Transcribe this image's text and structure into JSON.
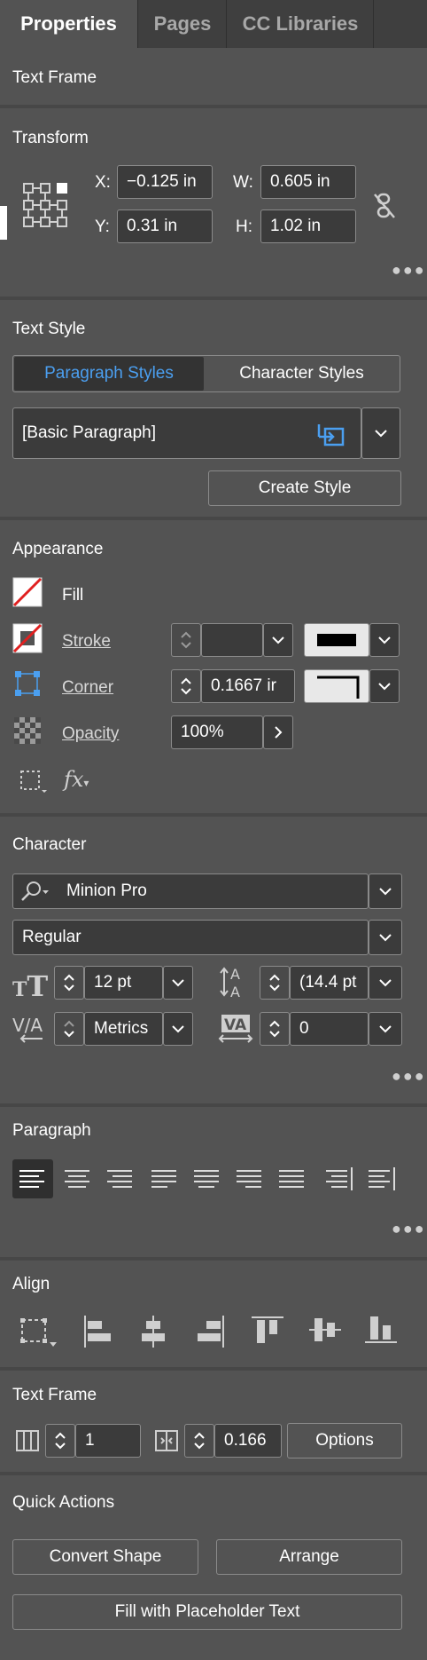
{
  "tabs": [
    "Properties",
    "Pages",
    "CC Libraries"
  ],
  "text_frame_header": "Text Frame",
  "transform": {
    "title": "Transform",
    "x_label": "X:",
    "x_value": "−0.125 in",
    "y_label": "Y:",
    "y_value": "0.31 in",
    "w_label": "W:",
    "w_value": "0.605 in",
    "h_label": "H:",
    "h_value": "1.02 in"
  },
  "text_style": {
    "title": "Text Style",
    "paragraph_tab": "Paragraph Styles",
    "character_tab": "Character Styles",
    "style_value": "[Basic Paragraph]",
    "create_style": "Create Style"
  },
  "appearance": {
    "title": "Appearance",
    "fill": "Fill",
    "stroke": "Stroke",
    "corner": "Corner",
    "corner_value": "0.1667 ir",
    "opacity": "Opacity",
    "opacity_value": "100%"
  },
  "character": {
    "title": "Character",
    "font": "Minion Pro",
    "style": "Regular",
    "size": "12 pt",
    "leading": "(14.4 pt",
    "kerning": "Metrics",
    "tracking": "0"
  },
  "paragraph": {
    "title": "Paragraph"
  },
  "align": {
    "title": "Align"
  },
  "text_frame": {
    "title": "Text Frame",
    "columns": "1",
    "gutter": "0.166",
    "options": "Options"
  },
  "quick_actions": {
    "title": "Quick Actions",
    "convert_shape": "Convert Shape",
    "arrange": "Arrange",
    "fill_placeholder": "Fill with Placeholder Text"
  },
  "colors": {
    "accent": "#4b9ff0",
    "panel": "#535353",
    "field": "#3b3b3b",
    "fill_none": "#e02020"
  }
}
